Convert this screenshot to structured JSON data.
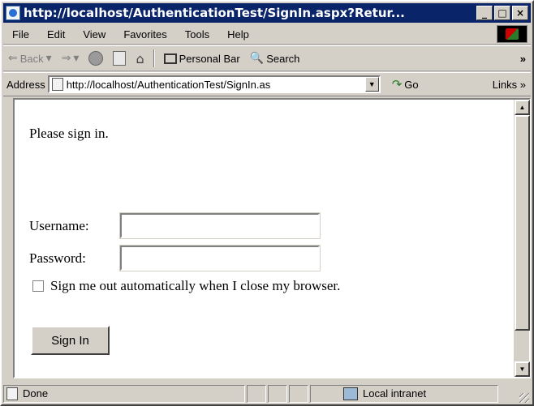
{
  "window": {
    "title": "http://localhost/AuthenticationTest/SignIn.aspx?Retur...",
    "buttons": {
      "minimize": "_",
      "maximize": "□",
      "close": "×"
    }
  },
  "menubar": {
    "items": [
      "File",
      "Edit",
      "View",
      "Favorites",
      "Tools",
      "Help"
    ]
  },
  "toolbar": {
    "back_label": "Back",
    "search_label": "Search",
    "personal_bar_label": "Personal Bar",
    "more": "»"
  },
  "addressbar": {
    "label": "Address",
    "url": "http://localhost/AuthenticationTest/SignIn.as",
    "go_label": "Go",
    "links_label": "Links »"
  },
  "page": {
    "intro": "Please sign in.",
    "username_label": "Username:",
    "username_value": "",
    "password_label": "Password:",
    "password_value": "",
    "remember_label": "Sign me out automatically when I close my browser.",
    "remember_checked": false,
    "signin_label": "Sign In"
  },
  "statusbar": {
    "status": "Done",
    "zone": "Local intranet"
  },
  "icons": {
    "title": "ie-page-icon",
    "throbber": "windows-logo-icon",
    "back": "back-arrow-icon",
    "forward": "forward-arrow-icon",
    "stop": "stop-icon",
    "refresh": "refresh-icon",
    "home": "home-icon",
    "personal_bar": "personal-bar-icon",
    "search": "search-icon",
    "go": "go-arrow-icon",
    "zone": "intranet-zone-icon"
  }
}
